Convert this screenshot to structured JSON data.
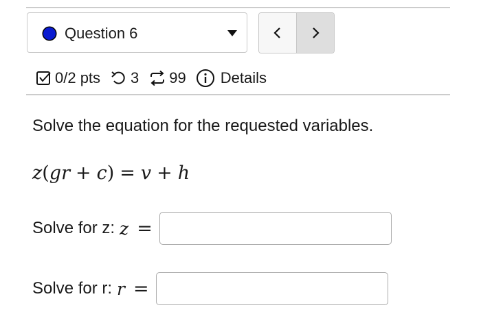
{
  "question_select": {
    "label": "Question 6",
    "status_color": "#0a1bd1"
  },
  "nav": {
    "prev_icon": "chevron-left-icon",
    "next_icon": "chevron-right-icon"
  },
  "meta": {
    "points": "0/2 pts",
    "attempts": "3",
    "attempts_icon": "retry-icon",
    "submissions": "99",
    "submissions_icon": "repeat-icon",
    "details_label": "Details",
    "details_icon": "info-icon"
  },
  "prompt": "Solve the equation for the requested variables.",
  "equation": {
    "lhs_var": "z",
    "inner_1": "gr",
    "plus": "+",
    "inner_2": "c",
    "equals": "=",
    "rhs_1": "v",
    "rhs_plus": "+",
    "rhs_2": "h"
  },
  "answers": [
    {
      "label": "Solve for z:",
      "variable": "z",
      "equals": "=",
      "value": ""
    },
    {
      "label": "Solve for r:",
      "variable": "r",
      "equals": "=",
      "value": ""
    }
  ]
}
